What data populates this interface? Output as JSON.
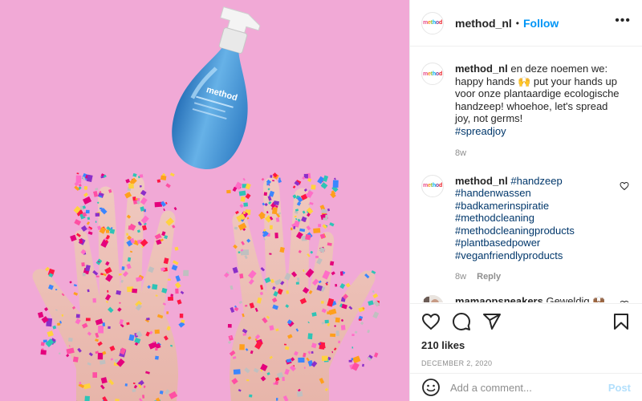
{
  "post": {
    "username": "method_nl",
    "separator": "•",
    "follow_label": "Follow",
    "more_label": "•••",
    "brand_logo": "method",
    "bottle_label": "method"
  },
  "comments": [
    {
      "username": "method_nl",
      "text": "en deze noemen we: happy hands 🙌 put your hands up voor onze plantaardige ecologische handzeep! whoehoe, let's spread joy, not germs!",
      "hashtag": "#spreadjoy",
      "age": "8w"
    },
    {
      "username": "method_nl",
      "hashtags": [
        "#handzeep",
        "#handenwassen",
        "#badkamerinspiratie",
        "#methodcleaning",
        "#methodcleaningproducts",
        "#plantbasedpower",
        "#veganfriendlyproducts"
      ],
      "age": "8w",
      "reply_label": "Reply"
    },
    {
      "username": "mamaopsneakers",
      "text": "Geweldig 🙌🏾",
      "extra": "🙌"
    }
  ],
  "actions": {
    "likes": "210 likes",
    "date": "DECEMBER 2, 2020"
  },
  "add_comment": {
    "placeholder": "Add a comment...",
    "post_label": "Post"
  },
  "icons": {
    "like": "heart-icon",
    "comment": "comment-icon",
    "share": "share-icon",
    "save": "bookmark-icon",
    "emoji": "emoji-icon",
    "more": "more-icon"
  },
  "colors": {
    "photo_background": "#f1a9d6",
    "follow": "#0095f6",
    "hashtag": "#00376b",
    "muted": "#8e8e8e",
    "post_disabled": "#b2dffc"
  }
}
